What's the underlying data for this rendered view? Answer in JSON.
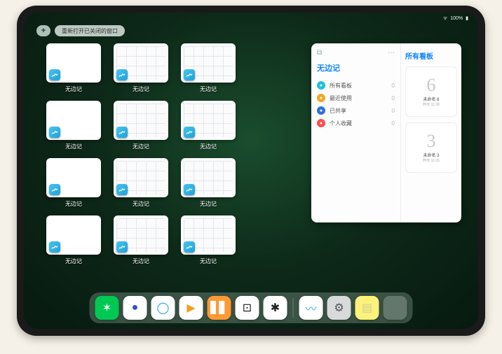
{
  "status": {
    "battery_text": "100%"
  },
  "top": {
    "plus": "+",
    "reopen_label": "重新打开已关闭的窗口"
  },
  "thumbs": [
    {
      "label": "无边记",
      "style": "blank"
    },
    {
      "label": "无边记",
      "style": "grid"
    },
    {
      "label": "无边记",
      "style": "grid"
    },
    {
      "label": "",
      "style": "empty"
    },
    {
      "label": "无边记",
      "style": "blank"
    },
    {
      "label": "无边记",
      "style": "grid"
    },
    {
      "label": "无边记",
      "style": "grid"
    },
    {
      "label": "",
      "style": "empty"
    },
    {
      "label": "无边记",
      "style": "blank"
    },
    {
      "label": "无边记",
      "style": "grid"
    },
    {
      "label": "无边记",
      "style": "grid"
    },
    {
      "label": "",
      "style": "empty"
    },
    {
      "label": "无边记",
      "style": "blank"
    },
    {
      "label": "无边记",
      "style": "grid"
    },
    {
      "label": "无边记",
      "style": "grid"
    }
  ],
  "panel": {
    "title": "无边记",
    "subtitle": "所有看板",
    "more": "···",
    "sidebar": [
      {
        "icon_color": "#1dc0e0",
        "label": "所有看板",
        "count": "0"
      },
      {
        "icon_color": "#f6a623",
        "label": "最近使用",
        "count": "0"
      },
      {
        "icon_color": "#2f6fe0",
        "label": "已共享",
        "count": "0"
      },
      {
        "icon_color": "#ff4d4d",
        "label": "个人收藏",
        "count": "0"
      }
    ],
    "boards": [
      {
        "sketch": "6",
        "caption": "未命名 6",
        "sub": "昨天 11:28"
      },
      {
        "sketch": "3",
        "caption": "未命名 3",
        "sub": "昨天 11:25"
      }
    ]
  },
  "dock": {
    "items": [
      {
        "name": "wechat",
        "bg": "#00c853",
        "glyph": "✶",
        "glyph_color": "#fff"
      },
      {
        "name": "browser-1",
        "bg": "#ffffff",
        "glyph": "●",
        "glyph_color": "#2e4fd6"
      },
      {
        "name": "browser-2",
        "bg": "#ffffff",
        "glyph": "◯",
        "glyph_color": "#1a9af0"
      },
      {
        "name": "play",
        "bg": "#ffffff",
        "glyph": "▶",
        "glyph_color": "#f0a020"
      },
      {
        "name": "books",
        "bg": "#ff9933",
        "glyph": "▋▋",
        "glyph_color": "#fff"
      },
      {
        "name": "dice",
        "bg": "#ffffff",
        "glyph": "⊡",
        "glyph_color": "#222"
      },
      {
        "name": "connect",
        "bg": "#ffffff",
        "glyph": "✱",
        "glyph_color": "#222"
      }
    ],
    "recent": [
      {
        "name": "freeform",
        "bg": "#ffffff",
        "glyph": "〰",
        "glyph_color": "#22b8f0"
      },
      {
        "name": "settings",
        "bg": "#d8d9db",
        "glyph": "⚙",
        "glyph_color": "#555"
      },
      {
        "name": "notes",
        "bg": "#fff27a",
        "glyph": "▤",
        "glyph_color": "#cc9"
      }
    ],
    "library": {
      "c1": "#2e9bf0",
      "c2": "#39c27a",
      "c3": "#9d6bf0",
      "c4": "#1aa4e8"
    }
  }
}
